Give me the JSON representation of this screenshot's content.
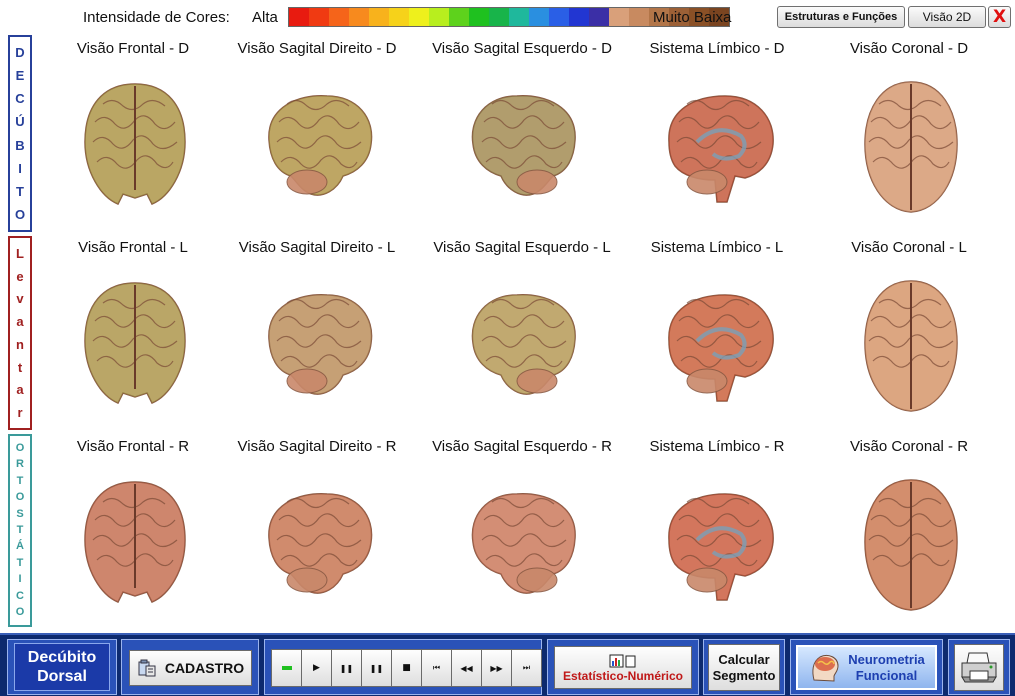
{
  "header": {
    "intensity_label": "Intensidade de Cores:",
    "high_label": "Alta",
    "low_label": "Muito Baixa",
    "color_scale": [
      "#e81b10",
      "#f03a12",
      "#f5641a",
      "#f78a1e",
      "#f8b21c",
      "#f6d21a",
      "#eef01c",
      "#b8ee1e",
      "#5ed21c",
      "#1fc11f",
      "#18b44a",
      "#1fb89c",
      "#2a8fe0",
      "#2a5fe6",
      "#2236d2",
      "#3b2fa6",
      "#d9a07a",
      "#c88a60",
      "#b27548",
      "#9c6036",
      "#8a5026",
      "#7a4420"
    ],
    "btn_structures": "Estruturas e Funções",
    "btn_2d": "Visão 2D",
    "btn_close": "X"
  },
  "side_labels": {
    "decubito": [
      "D",
      "E",
      "C",
      "Ú",
      "B",
      "I",
      "T",
      "O"
    ],
    "levantar": [
      "L",
      "e",
      "v",
      "a",
      "n",
      "t",
      "a",
      "r"
    ],
    "ortostatico": [
      "O",
      "R",
      "T",
      "O",
      "S",
      "T",
      "Á",
      "T",
      "I",
      "C",
      "O"
    ]
  },
  "rows": [
    {
      "key": "d",
      "views": [
        {
          "title": "Visão Frontal - D",
          "shape": "front",
          "tint": "#9a9a3a"
        },
        {
          "title": "Visão Sagital Direito - D",
          "shape": "sag-right",
          "tint": "#a39a3a"
        },
        {
          "title": "Visão Sagital Esquerdo - D",
          "shape": "sag-left",
          "tint": "#8a8a4a"
        },
        {
          "title": "Sistema Límbico - D",
          "shape": "limbic",
          "tint": "#c0402a"
        },
        {
          "title": "Visão Coronal - D",
          "shape": "top",
          "tint": "#d9a07a"
        }
      ]
    },
    {
      "key": "l",
      "views": [
        {
          "title": "Visão Frontal - L",
          "shape": "front",
          "tint": "#9a9a40"
        },
        {
          "title": "Visão Sagital Direito - L",
          "shape": "sag-right",
          "tint": "#b0905a"
        },
        {
          "title": "Visão Sagital Esquerdo - L",
          "shape": "sag-left",
          "tint": "#a8a050"
        },
        {
          "title": "Sistema Límbico - L",
          "shape": "limbic",
          "tint": "#c84a2a"
        },
        {
          "title": "Visão Coronal - L",
          "shape": "top",
          "tint": "#d99a70"
        }
      ]
    },
    {
      "key": "r",
      "views": [
        {
          "title": "Visão Frontal - R",
          "shape": "front",
          "tint": "#c0604a"
        },
        {
          "title": "Visão Sagital Direito - R",
          "shape": "sag-right",
          "tint": "#c26a4a"
        },
        {
          "title": "Visão Sagital Esquerdo - R",
          "shape": "sag-left",
          "tint": "#c8705a"
        },
        {
          "title": "Sistema Límbico - R",
          "shape": "limbic",
          "tint": "#c8442e"
        },
        {
          "title": "Visão Coronal - R",
          "shape": "top",
          "tint": "#c8704a"
        }
      ]
    }
  ],
  "toolbar": {
    "decubito_line1": "Decúbito",
    "decubito_line2": "Dorsal",
    "cadastro": "CADASTRO",
    "playback": [
      "stop-green",
      "play",
      "pause",
      "pause-alt",
      "stop",
      "skip-start",
      "rewind",
      "fast-forward",
      "skip-end"
    ],
    "estatistico": "Estatístico-Numérico",
    "calc_line1": "Calcular",
    "calc_line2": "Segmento",
    "neuro_line1": "Neurometria",
    "neuro_line2": "Funcional"
  }
}
